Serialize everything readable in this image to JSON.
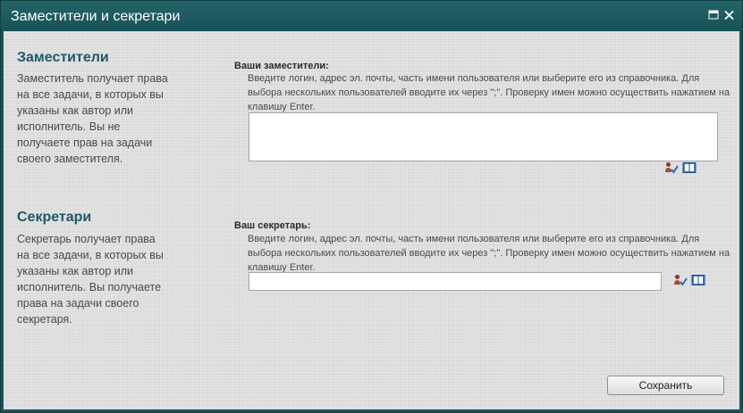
{
  "window": {
    "title": "Заместители и секретари"
  },
  "deputies": {
    "heading": "Заместители",
    "description": "Заместитель получает права на все задачи, в которых вы указаны как автор или исполнитель. Вы не получаете прав на задачи своего заместителя.",
    "field_label": "Ваши заместители:",
    "hint": "Введите логин, адрес эл. почты, часть имени пользователя или выберите его из справочника. Для выбора нескольких пользователей вводите их через \";\". Проверку имен можно осуществить нажатием на клавишу Enter.",
    "value": ""
  },
  "secretaries": {
    "heading": "Секретари",
    "description": "Секретарь получает права на все задачи, в которых вы указаны как автор или исполнитель. Вы получаете права на задачи своего секретаря.",
    "field_label": "Ваш секретарь:",
    "hint": "Введите логин, адрес эл. почты, часть имени пользователя или выберите его из справочника. Для выбора нескольких пользователей вводите их через \";\". Проверку имен можно осуществить нажатием на клавишу Enter.",
    "value": ""
  },
  "icons": {
    "check_names": "check-names-icon",
    "browse_directory": "address-book-icon",
    "maximize": "maximize-icon",
    "close": "close-icon"
  },
  "actions": {
    "save_label": "Сохранить"
  },
  "colors": {
    "titlebar": "#1a5459",
    "heading": "#1f5a63",
    "background": "#dcdcdc"
  }
}
